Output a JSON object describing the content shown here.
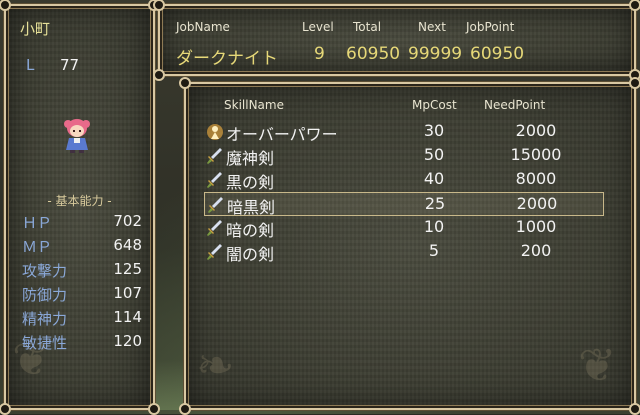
{
  "status": {
    "name": "小町",
    "level_label": "L",
    "level": "77",
    "stats_heading": "- 基本能力 -",
    "stats": [
      {
        "label": "ＨＰ",
        "value": "702"
      },
      {
        "label": "ＭＰ",
        "value": "648"
      },
      {
        "label": "攻撃力",
        "value": "125"
      },
      {
        "label": "防御力",
        "value": "107"
      },
      {
        "label": "精神力",
        "value": "114"
      },
      {
        "label": "敏捷性",
        "value": "120"
      }
    ]
  },
  "job": {
    "headers": {
      "job": "JobName",
      "level": "Level",
      "total": "Total",
      "next": "Next",
      "jobpoint": "JobPoint"
    },
    "name": "ダークナイト",
    "level": "9",
    "total": "60950",
    "next": "99999",
    "jobpoint": "60950"
  },
  "skills": {
    "headers": {
      "name": "SkillName",
      "mp": "MpCost",
      "need": "NeedPoint"
    },
    "selected_index": 3,
    "items": [
      {
        "icon": "aura-icon",
        "name": "オーバーパワー",
        "mp": "30",
        "need": "2000"
      },
      {
        "icon": "sword-icon",
        "name": "魔神剣",
        "mp": "50",
        "need": "15000"
      },
      {
        "icon": "sword-icon",
        "name": "黒の剣",
        "mp": "40",
        "need": "8000"
      },
      {
        "icon": "sword-icon",
        "name": "暗黒剣",
        "mp": "25",
        "need": "2000"
      },
      {
        "icon": "sword-icon",
        "name": "暗の剣",
        "mp": "10",
        "need": "1000"
      },
      {
        "icon": "sword-icon",
        "name": "闇の剣",
        "mp": "5",
        "need": "200"
      }
    ]
  },
  "colors": {
    "label_blue": "#8aa8d8",
    "value_white": "#f2f2f2",
    "job_gold": "#e6d878",
    "name_yellow": "#e6e098",
    "frame": "#d9c8a2"
  }
}
